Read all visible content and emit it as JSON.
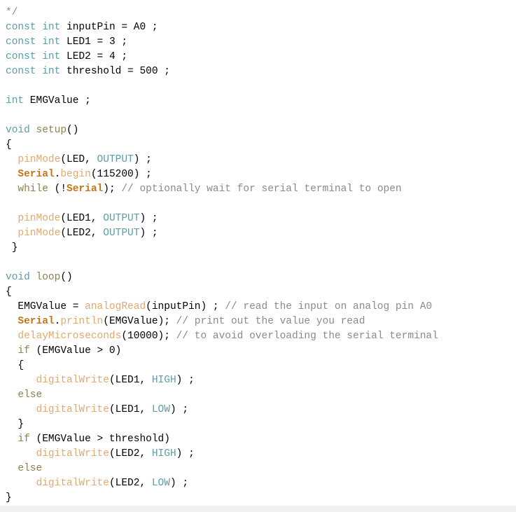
{
  "editor": {
    "language": "arduino-c",
    "background_color": "#ffffff",
    "font_size_px": 14.5,
    "line_height_px": 21,
    "colors": {
      "keyword": "#5b9ea6",
      "constant": "#5b9ea6",
      "function": "#e0a96d",
      "object": "#c4761a",
      "control": "#8c8250",
      "comment": "#8a8a8a",
      "plain": "#000000"
    },
    "lines": [
      {
        "index": 0,
        "text": "*/",
        "tokens": [
          {
            "t": "*/",
            "c": "t-comment"
          }
        ]
      },
      {
        "index": 1,
        "text": "const int inputPin = A0 ;",
        "tokens": [
          {
            "t": "const",
            "c": "t-keyword"
          },
          {
            "t": " ",
            "c": "t-plain"
          },
          {
            "t": "int",
            "c": "t-keyword"
          },
          {
            "t": " inputPin = A0 ;",
            "c": "t-plain"
          }
        ]
      },
      {
        "index": 2,
        "text": "const int LED1 = 3 ;",
        "tokens": [
          {
            "t": "const",
            "c": "t-keyword"
          },
          {
            "t": " ",
            "c": "t-plain"
          },
          {
            "t": "int",
            "c": "t-keyword"
          },
          {
            "t": " LED1 = 3 ;",
            "c": "t-plain"
          }
        ]
      },
      {
        "index": 3,
        "text": "const int LED2 = 4 ;",
        "tokens": [
          {
            "t": "const",
            "c": "t-keyword"
          },
          {
            "t": " ",
            "c": "t-plain"
          },
          {
            "t": "int",
            "c": "t-keyword"
          },
          {
            "t": " LED2 = 4 ;",
            "c": "t-plain"
          }
        ]
      },
      {
        "index": 4,
        "text": "const int threshold = 500 ;",
        "tokens": [
          {
            "t": "const",
            "c": "t-keyword"
          },
          {
            "t": " ",
            "c": "t-plain"
          },
          {
            "t": "int",
            "c": "t-keyword"
          },
          {
            "t": " threshold = 500 ;",
            "c": "t-plain"
          }
        ]
      },
      {
        "index": 5,
        "text": "",
        "tokens": []
      },
      {
        "index": 6,
        "text": "int EMGValue ;",
        "tokens": [
          {
            "t": "int",
            "c": "t-keyword"
          },
          {
            "t": " EMGValue ;",
            "c": "t-plain"
          }
        ]
      },
      {
        "index": 7,
        "text": "",
        "tokens": []
      },
      {
        "index": 8,
        "text": "void setup()",
        "tokens": [
          {
            "t": "void",
            "c": "t-keyword"
          },
          {
            "t": " ",
            "c": "t-plain"
          },
          {
            "t": "setup",
            "c": "t-control"
          },
          {
            "t": "()",
            "c": "t-plain"
          }
        ]
      },
      {
        "index": 9,
        "text": "{",
        "tokens": [
          {
            "t": "{",
            "c": "t-brace"
          }
        ]
      },
      {
        "index": 10,
        "text": "  pinMode(LED, OUTPUT) ;",
        "tokens": [
          {
            "t": "  ",
            "c": "t-plain"
          },
          {
            "t": "pinMode",
            "c": "t-function"
          },
          {
            "t": "(LED, ",
            "c": "t-plain"
          },
          {
            "t": "OUTPUT",
            "c": "t-constant"
          },
          {
            "t": ") ;",
            "c": "t-plain"
          }
        ]
      },
      {
        "index": 11,
        "text": "  Serial.begin(115200) ;",
        "tokens": [
          {
            "t": "  ",
            "c": "t-plain"
          },
          {
            "t": "Serial",
            "c": "t-object"
          },
          {
            "t": ".",
            "c": "t-plain"
          },
          {
            "t": "begin",
            "c": "t-function"
          },
          {
            "t": "(115200) ;",
            "c": "t-plain"
          }
        ]
      },
      {
        "index": 12,
        "text": "  while (!Serial); // optionally wait for serial terminal to open",
        "tokens": [
          {
            "t": "  ",
            "c": "t-plain"
          },
          {
            "t": "while",
            "c": "t-control"
          },
          {
            "t": " (!",
            "c": "t-plain"
          },
          {
            "t": "Serial",
            "c": "t-object"
          },
          {
            "t": "); ",
            "c": "t-plain"
          },
          {
            "t": "// optionally wait for serial terminal to open",
            "c": "t-comment"
          }
        ]
      },
      {
        "index": 13,
        "text": "",
        "tokens": []
      },
      {
        "index": 14,
        "text": "  pinMode(LED1, OUTPUT) ;",
        "tokens": [
          {
            "t": "  ",
            "c": "t-plain"
          },
          {
            "t": "pinMode",
            "c": "t-function"
          },
          {
            "t": "(LED1, ",
            "c": "t-plain"
          },
          {
            "t": "OUTPUT",
            "c": "t-constant"
          },
          {
            "t": ") ;",
            "c": "t-plain"
          }
        ]
      },
      {
        "index": 15,
        "text": "  pinMode(LED2, OUTPUT) ;",
        "tokens": [
          {
            "t": "  ",
            "c": "t-plain"
          },
          {
            "t": "pinMode",
            "c": "t-function"
          },
          {
            "t": "(LED2, ",
            "c": "t-plain"
          },
          {
            "t": "OUTPUT",
            "c": "t-constant"
          },
          {
            "t": ") ;",
            "c": "t-plain"
          }
        ]
      },
      {
        "index": 16,
        "text": " }",
        "tokens": [
          {
            "t": " }",
            "c": "t-brace"
          }
        ]
      },
      {
        "index": 17,
        "text": "",
        "tokens": []
      },
      {
        "index": 18,
        "text": "void loop()",
        "tokens": [
          {
            "t": "void",
            "c": "t-keyword"
          },
          {
            "t": " ",
            "c": "t-plain"
          },
          {
            "t": "loop",
            "c": "t-control"
          },
          {
            "t": "()",
            "c": "t-plain"
          }
        ]
      },
      {
        "index": 19,
        "text": "{",
        "tokens": [
          {
            "t": "{",
            "c": "t-brace"
          }
        ]
      },
      {
        "index": 20,
        "text": "  EMGValue = analogRead(inputPin) ; // read the input on analog pin A0",
        "tokens": [
          {
            "t": "  EMGValue = ",
            "c": "t-plain"
          },
          {
            "t": "analogRead",
            "c": "t-function"
          },
          {
            "t": "(inputPin) ; ",
            "c": "t-plain"
          },
          {
            "t": "// read the input on analog pin A0",
            "c": "t-comment"
          }
        ]
      },
      {
        "index": 21,
        "text": "  Serial.println(EMGValue); // print out the value you read",
        "tokens": [
          {
            "t": "  ",
            "c": "t-plain"
          },
          {
            "t": "Serial",
            "c": "t-object"
          },
          {
            "t": ".",
            "c": "t-plain"
          },
          {
            "t": "println",
            "c": "t-function"
          },
          {
            "t": "(EMGValue); ",
            "c": "t-plain"
          },
          {
            "t": "// print out the value you read",
            "c": "t-comment"
          }
        ]
      },
      {
        "index": 22,
        "text": "  delayMicroseconds(10000); // to avoid overloading the serial terminal",
        "tokens": [
          {
            "t": "  ",
            "c": "t-plain"
          },
          {
            "t": "delayMicroseconds",
            "c": "t-function"
          },
          {
            "t": "(10000); ",
            "c": "t-plain"
          },
          {
            "t": "// to avoid overloading the serial terminal",
            "c": "t-comment"
          }
        ]
      },
      {
        "index": 23,
        "text": "  if (EMGValue > 0)",
        "tokens": [
          {
            "t": "  ",
            "c": "t-plain"
          },
          {
            "t": "if",
            "c": "t-control"
          },
          {
            "t": " (EMGValue > 0)",
            "c": "t-plain"
          }
        ]
      },
      {
        "index": 24,
        "text": "  {",
        "tokens": [
          {
            "t": "  {",
            "c": "t-brace"
          }
        ]
      },
      {
        "index": 25,
        "text": "     digitalWrite(LED1, HIGH) ;",
        "tokens": [
          {
            "t": "     ",
            "c": "t-plain"
          },
          {
            "t": "digitalWrite",
            "c": "t-function"
          },
          {
            "t": "(LED1, ",
            "c": "t-plain"
          },
          {
            "t": "HIGH",
            "c": "t-constant"
          },
          {
            "t": ") ;",
            "c": "t-plain"
          }
        ]
      },
      {
        "index": 26,
        "text": "  else",
        "tokens": [
          {
            "t": "  ",
            "c": "t-plain"
          },
          {
            "t": "else",
            "c": "t-control"
          }
        ]
      },
      {
        "index": 27,
        "text": "     digitalWrite(LED1, LOW) ;",
        "tokens": [
          {
            "t": "     ",
            "c": "t-plain"
          },
          {
            "t": "digitalWrite",
            "c": "t-function"
          },
          {
            "t": "(LED1, ",
            "c": "t-plain"
          },
          {
            "t": "LOW",
            "c": "t-constant"
          },
          {
            "t": ") ;",
            "c": "t-plain"
          }
        ]
      },
      {
        "index": 28,
        "text": "  }",
        "tokens": [
          {
            "t": "  }",
            "c": "t-brace"
          }
        ]
      },
      {
        "index": 29,
        "text": "  if (EMGValue > threshold)",
        "tokens": [
          {
            "t": "  ",
            "c": "t-plain"
          },
          {
            "t": "if",
            "c": "t-control"
          },
          {
            "t": " (EMGValue > threshold)",
            "c": "t-plain"
          }
        ]
      },
      {
        "index": 30,
        "text": "     digitalWrite(LED2, HIGH) ;",
        "tokens": [
          {
            "t": "     ",
            "c": "t-plain"
          },
          {
            "t": "digitalWrite",
            "c": "t-function"
          },
          {
            "t": "(LED2, ",
            "c": "t-plain"
          },
          {
            "t": "HIGH",
            "c": "t-constant"
          },
          {
            "t": ") ;",
            "c": "t-plain"
          }
        ]
      },
      {
        "index": 31,
        "text": "  else",
        "tokens": [
          {
            "t": "  ",
            "c": "t-plain"
          },
          {
            "t": "else",
            "c": "t-control"
          }
        ]
      },
      {
        "index": 32,
        "text": "     digitalWrite(LED2, LOW) ;",
        "tokens": [
          {
            "t": "     ",
            "c": "t-plain"
          },
          {
            "t": "digitalWrite",
            "c": "t-function"
          },
          {
            "t": "(LED2, ",
            "c": "t-plain"
          },
          {
            "t": "LOW",
            "c": "t-constant"
          },
          {
            "t": ") ;",
            "c": "t-plain"
          }
        ]
      },
      {
        "index": 33,
        "text": "}",
        "tokens": [
          {
            "t": "}",
            "c": "t-brace"
          }
        ]
      }
    ]
  }
}
